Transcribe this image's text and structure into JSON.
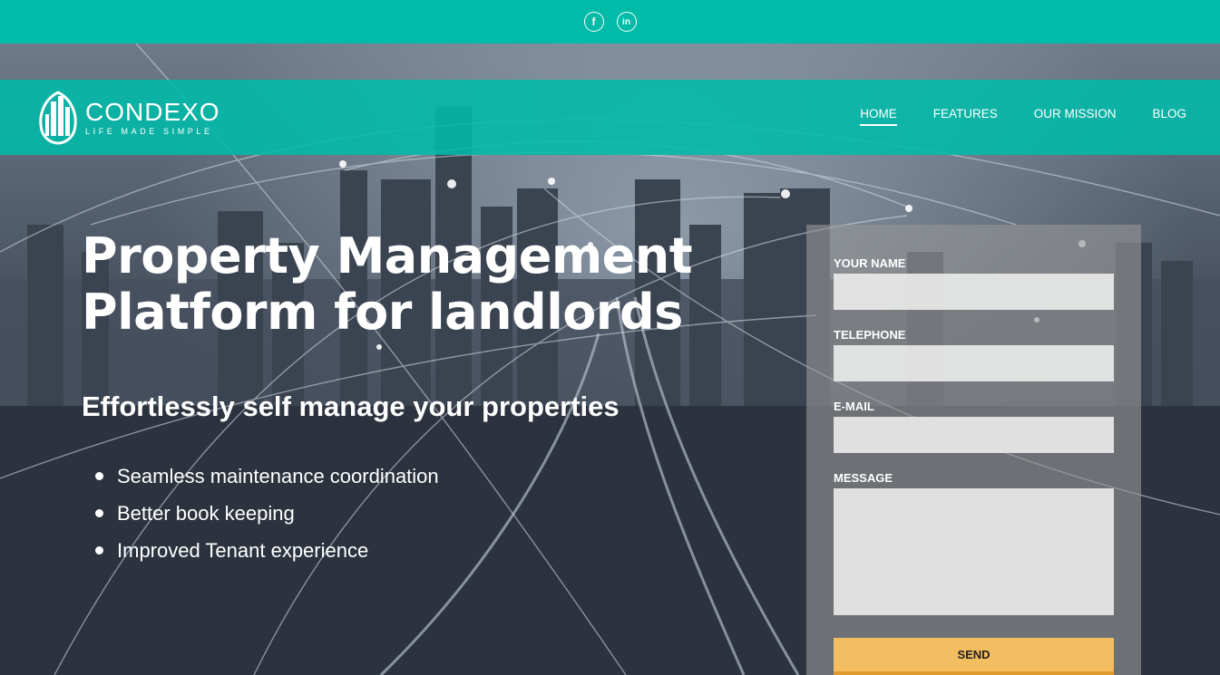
{
  "topbar": {
    "social": [
      {
        "glyph": "f",
        "icon": "facebook-icon"
      },
      {
        "glyph": "in",
        "icon": "linkedin-icon"
      }
    ],
    "color": "#00bba8"
  },
  "logo": {
    "name": "CONDEXO",
    "tagline": "LIFE MADE SIMPLE"
  },
  "nav": {
    "items": [
      "HOME",
      "FEATURES",
      "OUR MISSION",
      "BLOG"
    ],
    "active": "HOME"
  },
  "hero": {
    "headline_line1": "Property Management",
    "headline_line2": "Platform for landlords",
    "subheadline": "Effortlessly self manage your properties",
    "bullets": [
      "Seamless maintenance coordination",
      "Better book keeping",
      "Improved Tenant experience"
    ]
  },
  "form": {
    "name_label": "YOUR NAME",
    "phone_label": "TELEPHONE",
    "email_label": "E-MAIL",
    "message_label": "MESSAGE",
    "send_label": "SEND",
    "send_color": "#f3bd62"
  }
}
